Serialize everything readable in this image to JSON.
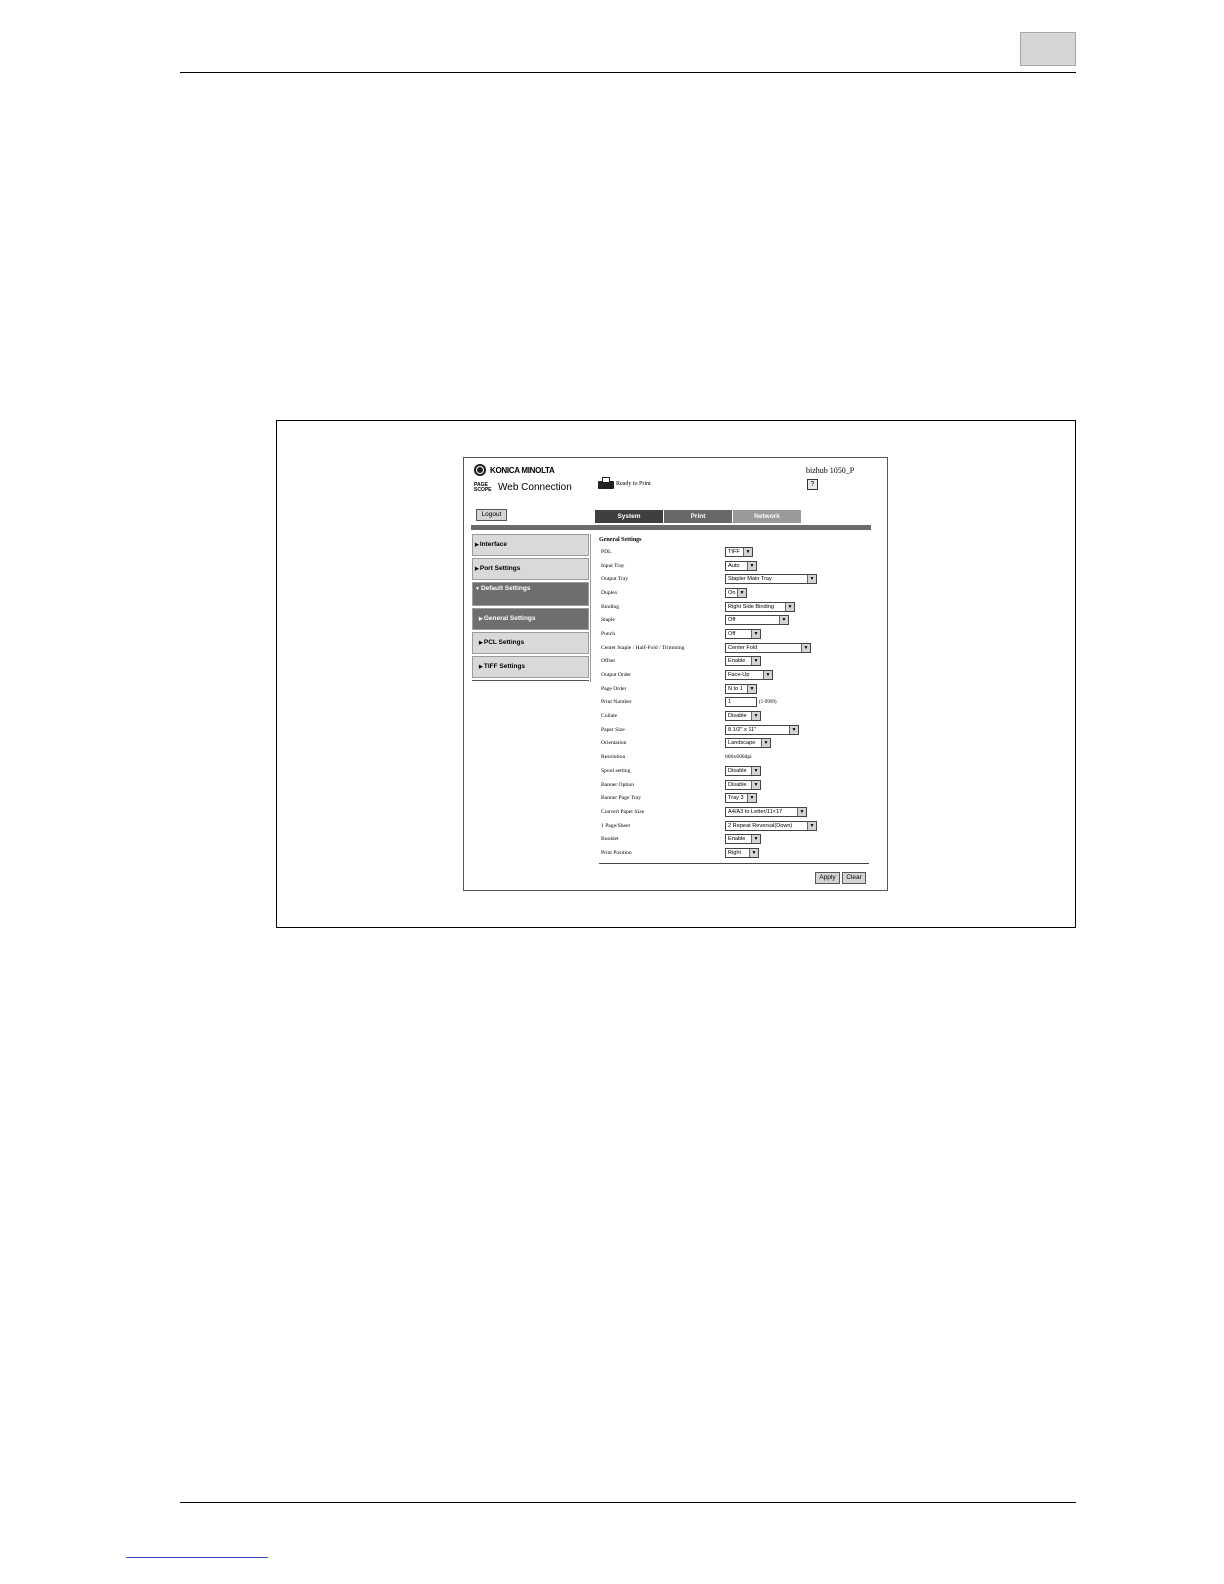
{
  "header": {
    "brand": "KONICA MINOLTA",
    "pagescope_line1": "PAGE",
    "pagescope_line2": "SCOPE",
    "title": "Web Connection",
    "status": "Ready to Print",
    "device": "bizhub 1050_P",
    "help": "?"
  },
  "logout_label": "Logout",
  "tabs": [
    {
      "label": "System"
    },
    {
      "label": "Print"
    },
    {
      "label": "Network"
    }
  ],
  "sidebar": {
    "items": [
      {
        "label": "Interface"
      },
      {
        "label": "Port Settings"
      },
      {
        "label": "Default Settings"
      },
      {
        "label": "General Settings"
      },
      {
        "label": "PCL Settings"
      },
      {
        "label": "TIFF Settings"
      }
    ]
  },
  "form": {
    "title": "General Settings",
    "rows": [
      {
        "label": "PDL",
        "value": "TIFF"
      },
      {
        "label": "Input Tray",
        "value": "Auto"
      },
      {
        "label": "Output Tray",
        "value": "Stapler Main Tray"
      },
      {
        "label": "Duplex",
        "value": "On"
      },
      {
        "label": "Binding",
        "value": "Right Side Binding"
      },
      {
        "label": "Staple",
        "value": "Off"
      },
      {
        "label": "Punch",
        "value": "Off"
      },
      {
        "label": "Center Staple / Half-Fold / Trimming",
        "value": "Center Fold"
      },
      {
        "label": "Offset",
        "value": "Enable"
      },
      {
        "label": "Output Order",
        "value": "Face-Up"
      },
      {
        "label": "Page Order",
        "value": "N to 1"
      },
      {
        "label": "Print Number",
        "value": "1",
        "range": "(1-9999)"
      },
      {
        "label": "Collate",
        "value": "Disable"
      },
      {
        "label": "Paper Size",
        "value": "8 1/2\" x 11\""
      },
      {
        "label": "Orientation",
        "value": "Landscape"
      },
      {
        "label": "Resolution",
        "value": "600x600dpi"
      },
      {
        "label": "Spool setting",
        "value": "Disable"
      },
      {
        "label": "Banner Option",
        "value": "Disable"
      },
      {
        "label": "Banner Page Tray",
        "value": "Tray 3"
      },
      {
        "label": "Convert Paper Size",
        "value": "A4/A3 to Letter/11×17"
      },
      {
        "label": "1 Page/Sheet",
        "value": "2 Repeat Reversal(Down)"
      },
      {
        "label": "Booklet",
        "value": "Enable"
      },
      {
        "label": "Print Position",
        "value": "Right"
      }
    ],
    "apply_label": "Apply",
    "clear_label": "Clear"
  }
}
